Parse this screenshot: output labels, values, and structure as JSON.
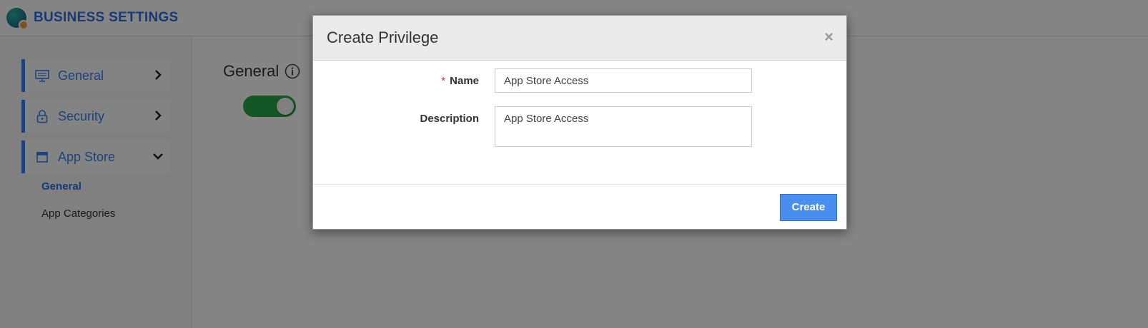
{
  "header": {
    "title": "BUSINESS SETTINGS"
  },
  "sidebar": {
    "items": [
      {
        "label": "General",
        "icon": "monitor-icon",
        "chevron": "chevron-right-icon"
      },
      {
        "label": "Security",
        "icon": "lock-icon",
        "chevron": "chevron-right-icon"
      },
      {
        "label": "App Store",
        "icon": "store-icon",
        "chevron": "chevron-down-icon"
      }
    ],
    "subitems": [
      {
        "label": "General",
        "active": true
      },
      {
        "label": "App Categories",
        "active": false
      }
    ]
  },
  "main": {
    "section_title": "General",
    "toggle_on": true
  },
  "modal": {
    "title": "Create Privilege",
    "close_symbol": "×",
    "required_marker": "*",
    "name_label": "Name",
    "name_value": "App Store Access",
    "description_label": "Description",
    "description_value": "App Store Access",
    "create_label": "Create"
  },
  "colors": {
    "accent": "#3f7ee8",
    "toggle_on": "#27a845",
    "button": "#4a8ef0",
    "required": "#e0282b"
  }
}
